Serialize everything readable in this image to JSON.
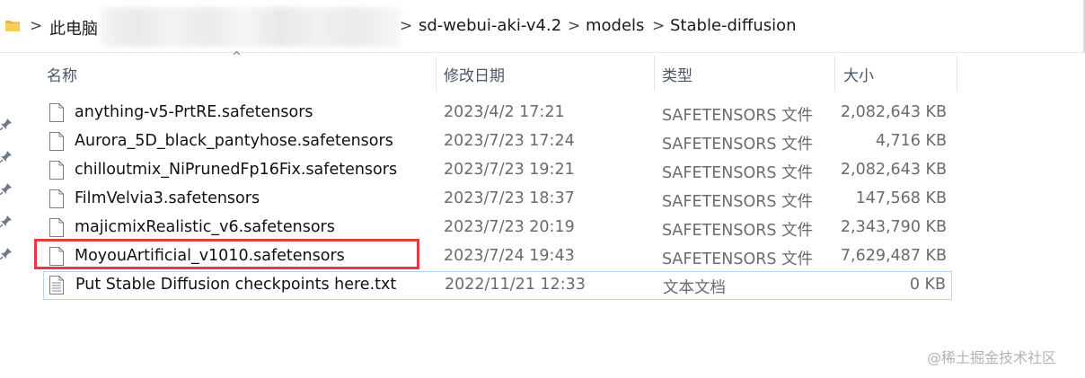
{
  "breadcrumb": {
    "items": [
      "此电脑",
      "sd-webui-aki-v4.2",
      "models",
      "Stable-diffusion"
    ],
    "separator": ">"
  },
  "columns": {
    "name": "名称",
    "date": "修改日期",
    "type": "类型",
    "size": "大小"
  },
  "files": [
    {
      "name": "anything-v5-PrtRE.safetensors",
      "date": "2023/4/2 17:21",
      "type": "SAFETENSORS 文件",
      "size": "2,082,643 KB"
    },
    {
      "name": "Aurora_5D_black_pantyhose.safetensors",
      "date": "2023/7/23 17:24",
      "type": "SAFETENSORS 文件",
      "size": "4,716 KB"
    },
    {
      "name": "chilloutmix_NiPrunedFp16Fix.safetensors",
      "date": "2023/7/23 19:21",
      "type": "SAFETENSORS 文件",
      "size": "2,082,643 KB"
    },
    {
      "name": "FilmVelvia3.safetensors",
      "date": "2023/7/23 18:37",
      "type": "SAFETENSORS 文件",
      "size": "147,568 KB"
    },
    {
      "name": "majicmixRealistic_v6.safetensors",
      "date": "2023/7/23 20:19",
      "type": "SAFETENSORS 文件",
      "size": "2,343,790 KB"
    },
    {
      "name": "MoyouArtificial_v1010.safetensors",
      "date": "2023/7/24 19:43",
      "type": "SAFETENSORS 文件",
      "size": "7,629,487 KB"
    },
    {
      "name": "Put Stable Diffusion checkpoints here.txt",
      "date": "2022/11/21 12:33",
      "type": "文本文档",
      "size": "0 KB"
    }
  ],
  "watermark": "@稀土掘金技术社区",
  "colors": {
    "highlight": "#e43a3f",
    "selection_border": "#b9d5ef",
    "folder": "#e8b43c"
  }
}
